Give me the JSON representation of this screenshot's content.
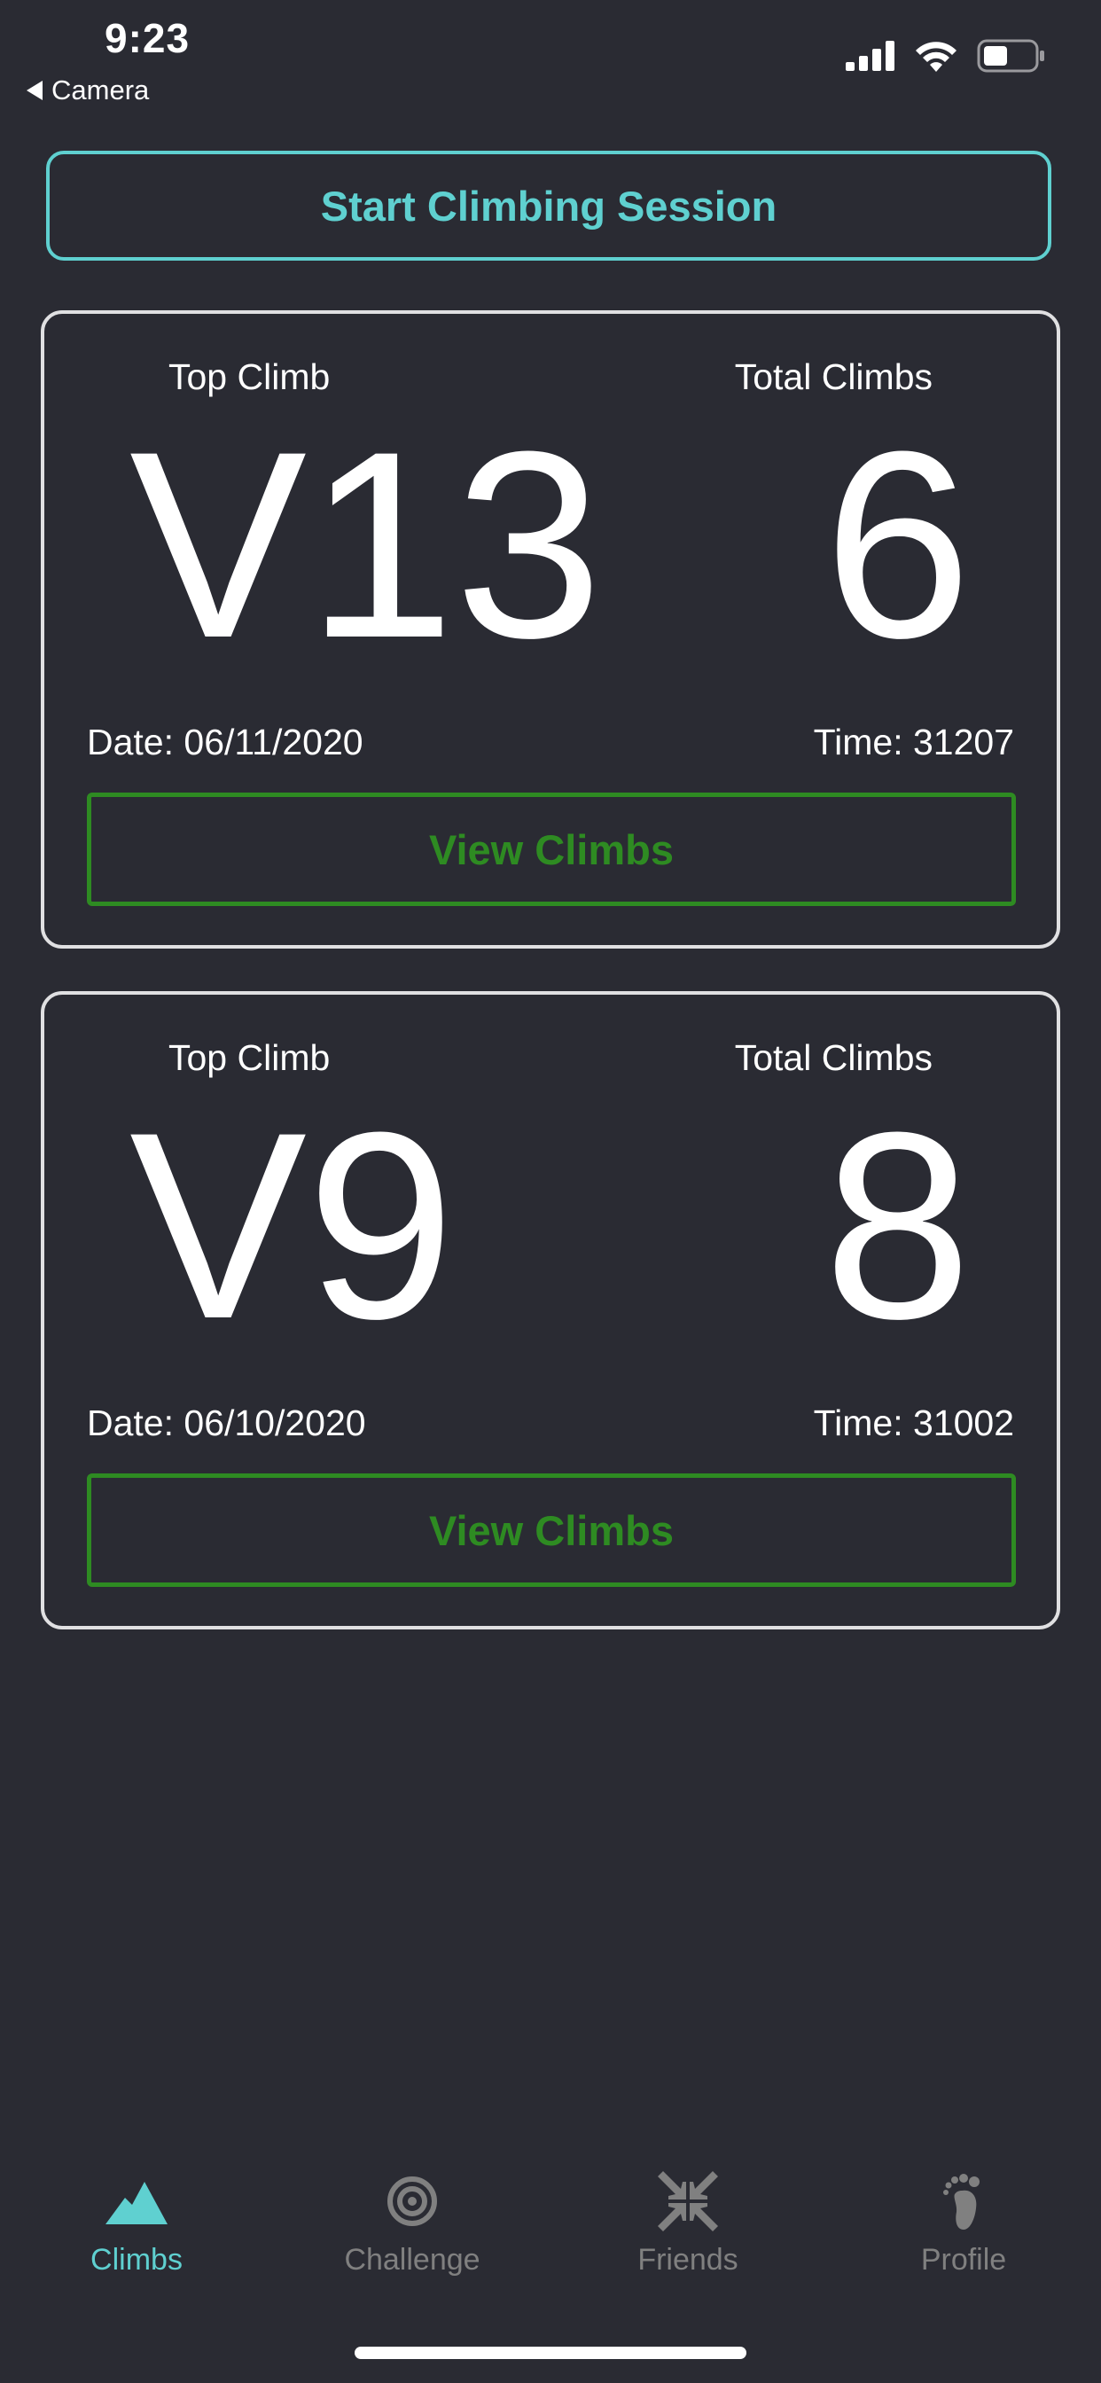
{
  "status_bar": {
    "time": "9:23",
    "back_label": "Camera",
    "icons": [
      "signal-icon",
      "wifi-icon",
      "battery-icon"
    ]
  },
  "start_session": {
    "label": "Start Climbing Session"
  },
  "sessions": [
    {
      "top_climb_label": "Top Climb",
      "total_climbs_label": "Total Climbs",
      "top_climb": "V13",
      "total_climbs": "6",
      "date": "Date: 06/11/2020",
      "time": "Time: 31207",
      "view_label": "View Climbs"
    },
    {
      "top_climb_label": "Top Climb",
      "total_climbs_label": "Total Climbs",
      "top_climb": "V9",
      "total_climbs": "8",
      "date": "Date: 06/10/2020",
      "time": "Time: 31002",
      "view_label": "View Climbs"
    }
  ],
  "tabs": [
    {
      "label": "Climbs",
      "icon": "mountain-icon",
      "active": true
    },
    {
      "label": "Challenge",
      "icon": "target-icon",
      "active": false
    },
    {
      "label": "Friends",
      "icon": "arrows-in-icon",
      "active": false
    },
    {
      "label": "Profile",
      "icon": "footprint-icon",
      "active": false
    }
  ],
  "colors": {
    "background": "#2a2b33",
    "accent": "#5fd0d0",
    "view_button": "#2e8b22",
    "card_border": "#e0e0e2",
    "inactive_tab": "#808080"
  }
}
